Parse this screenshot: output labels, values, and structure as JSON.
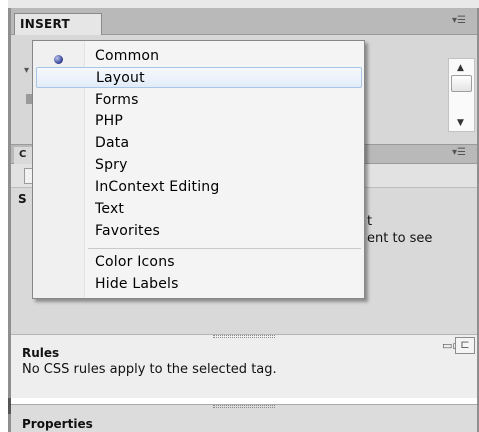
{
  "insert_panel": {
    "tab_label": "INSERT",
    "menu_icon": "panel-options-icon"
  },
  "css_panel": {
    "tab_label": "C",
    "summary_heading": "S",
    "summary_text_line1": "t",
    "summary_text_line2": "ent to see"
  },
  "category_menu": {
    "selected": "Common",
    "items": [
      {
        "label": "Common"
      },
      {
        "label": "Layout"
      },
      {
        "label": "Forms"
      },
      {
        "label": "PHP"
      },
      {
        "label": "Data"
      },
      {
        "label": "Spry"
      },
      {
        "label": "InContext Editing"
      },
      {
        "label": "Text"
      },
      {
        "label": "Favorites"
      }
    ],
    "options": [
      {
        "label": "Color Icons"
      },
      {
        "label": "Hide Labels"
      }
    ]
  },
  "rules_panel": {
    "heading": "Rules",
    "message": "No CSS rules apply to the selected tag."
  },
  "properties_panel": {
    "heading": "Properties"
  },
  "colors": {
    "menu_hover_border": "#a8c5e6",
    "radio_dot": "#2b3a8c",
    "panel_header": "#b9b9b9"
  }
}
